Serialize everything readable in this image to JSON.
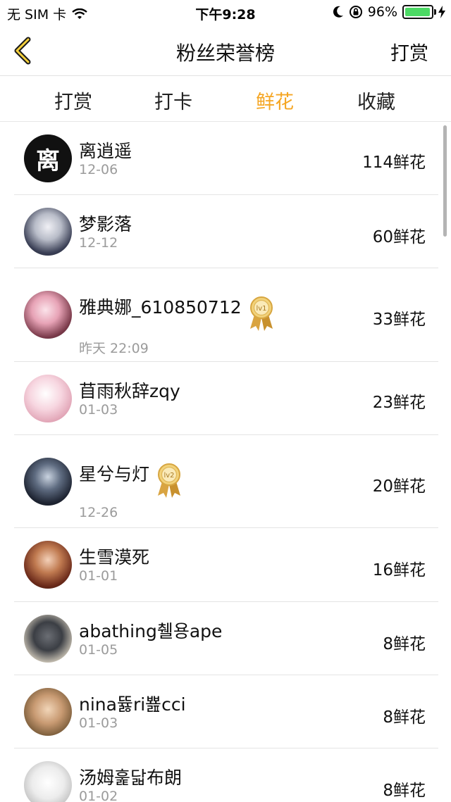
{
  "status_bar": {
    "carrier": "无 SIM 卡",
    "time": "下午9:28",
    "battery_percent": "96%",
    "battery_level": 0.96
  },
  "nav": {
    "title": "粉丝荣誉榜",
    "right_action": "打赏"
  },
  "tabs": [
    {
      "label": "打赏",
      "active": false
    },
    {
      "label": "打卡",
      "active": false
    },
    {
      "label": "鲜花",
      "active": true
    },
    {
      "label": "收藏",
      "active": false
    }
  ],
  "colors": {
    "accent": "#f5a623",
    "secondary_text": "#9b9b9b",
    "divider": "#e4e4e4"
  },
  "fans": [
    {
      "name": "离逍遥",
      "date": "12-06",
      "count": "114鲜花",
      "avatar_char": "离"
    },
    {
      "name": "梦影落",
      "date": "12-12",
      "count": "60鲜花"
    },
    {
      "name": "雅典娜_610850712",
      "date": "昨天 22:09",
      "count": "33鲜花",
      "badge": "lv1"
    },
    {
      "name": "苜雨秋辞zqy",
      "date": "01-03",
      "count": "23鲜花"
    },
    {
      "name": "星兮与灯",
      "date": "12-26",
      "count": "20鲜花",
      "badge": "lv2"
    },
    {
      "name": "生雪漠死",
      "date": "01-01",
      "count": "16鲜花"
    },
    {
      "name": "abathing췔용ape",
      "date": "01-05",
      "count": "8鲜花"
    },
    {
      "name": "nina뜛ri뾾cci",
      "date": "01-03",
      "count": "8鲜花"
    },
    {
      "name": "汤姆훑닯布朗",
      "date": "01-02",
      "count": "8鲜花"
    }
  ]
}
